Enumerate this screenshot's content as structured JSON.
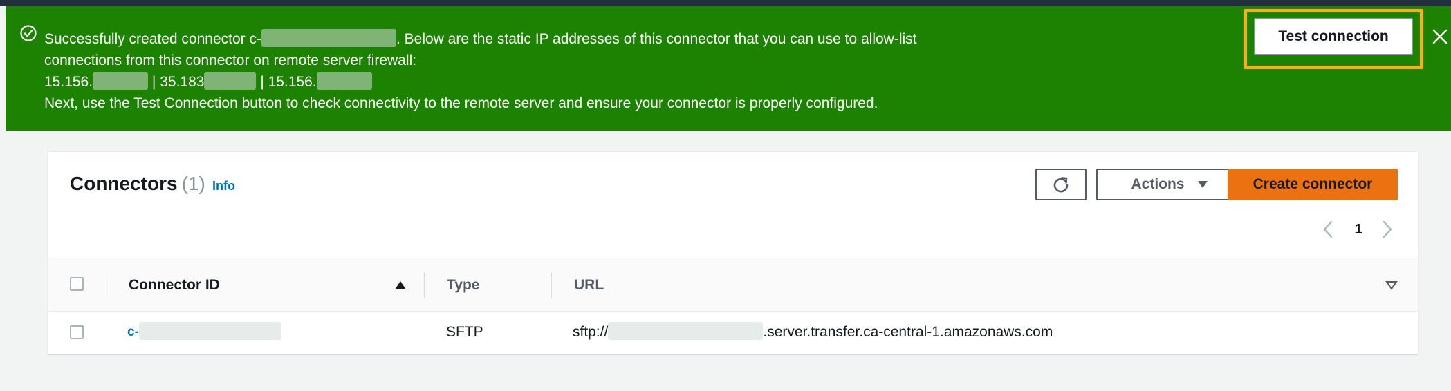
{
  "flash": {
    "message_part1": "Successfully created connector c-",
    "message_part2": ". Below are the static IP addresses of this connector that you can use to allow-list",
    "message_line2": "connections from this connector on remote server firewall:",
    "ip1_prefix": "15.156.",
    "ip2_prefix": "35.183",
    "ip3_prefix": "15.156.",
    "ip_separator": "|",
    "message_line4": "Next, use the Test Connection button to check connectivity to the remote server and ensure your connector is properly configured.",
    "test_button_label": "Test connection",
    "status_color": "#1d8102",
    "highlight_color": "#f2b21b"
  },
  "panel": {
    "title": "Connectors",
    "count": "(1)",
    "info_label": "Info",
    "actions_label": "Actions",
    "create_label": "Create connector",
    "refresh_icon": "refresh-icon",
    "page_number": "1",
    "create_color": "#ec7211"
  },
  "table": {
    "columns": [
      "Connector ID",
      "Type",
      "URL"
    ],
    "rows": [
      {
        "connector_id_prefix": "c-",
        "type": "SFTP",
        "url_prefix": "sftp://",
        "url_suffix": ".server.transfer.ca-central-1.amazonaws.com"
      }
    ]
  }
}
